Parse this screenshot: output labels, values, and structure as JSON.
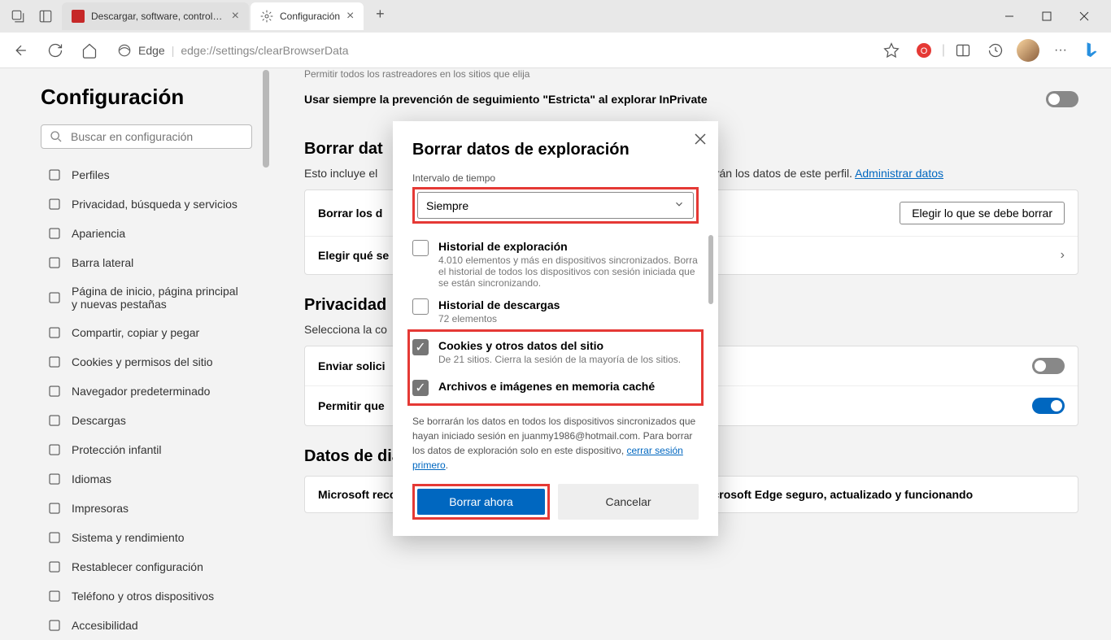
{
  "titlebar": {
    "tab1": "Descargar, software, controlador...",
    "tab2": "Configuración"
  },
  "toolbar": {
    "edge_label": "Edge",
    "url": "edge://settings/clearBrowserData"
  },
  "sidebar": {
    "title": "Configuración",
    "search_placeholder": "Buscar en configuración",
    "items": [
      "Perfiles",
      "Privacidad, búsqueda y servicios",
      "Apariencia",
      "Barra lateral",
      "Página de inicio, página principal y nuevas pestañas",
      "Compartir, copiar y pegar",
      "Cookies y permisos del sitio",
      "Navegador predeterminado",
      "Descargas",
      "Protección infantil",
      "Idiomas",
      "Impresoras",
      "Sistema y rendimiento",
      "Restablecer configuración",
      "Teléfono y otros dispositivos",
      "Accesibilidad"
    ]
  },
  "main": {
    "tracker_sub": "Permitir todos los rastreadores en los sitios que elija",
    "strict_label": "Usar siempre la prevención de seguimiento \"Estricta\" al explorar InPrivate",
    "section1_title": "Borrar dat",
    "section1_desc_pre": "Esto incluye el ",
    "section1_desc_post": "arán los datos de este perfil. ",
    "manage_link": "Administrar datos",
    "card1_row1": "Borrar los d",
    "choose_btn": "Elegir lo que se debe borrar",
    "card1_row2": "Elegir qué se",
    "section2_title": "Privacidad",
    "section2_desc": "Selecciona la co",
    "send_label": "Enviar solici",
    "allow_label": "Permitir que",
    "section3_title": "Datos de diagnóstico requeridos",
    "diag_text": "Microsoft recopila los datos de diagnóstico necesarios para mantener Microsoft Edge seguro, actualizado y funcionando"
  },
  "modal": {
    "title": "Borrar datos de exploración",
    "time_label": "Intervalo de tiempo",
    "time_value": "Siempre",
    "items": [
      {
        "title": "Historial de exploración",
        "desc": "4.010 elementos y más en dispositivos sincronizados. Borra el historial de todos los dispositivos con sesión iniciada que se están sincronizando.",
        "checked": false
      },
      {
        "title": "Historial de descargas",
        "desc": "72 elementos",
        "checked": false
      },
      {
        "title": "Cookies y otros datos del sitio",
        "desc": "De 21 sitios. Cierra la sesión de la mayoría de los sitios.",
        "checked": true
      },
      {
        "title": "Archivos e imágenes en memoria caché",
        "desc": "",
        "checked": true
      }
    ],
    "note_pre": "Se borrarán los datos en todos los dispositivos sincronizados que hayan iniciado sesión en juanmy1986@hotmail.com. Para borrar los datos de exploración solo en este dispositivo, ",
    "note_link": "cerrar sesión primero",
    "clear_btn": "Borrar ahora",
    "cancel_btn": "Cancelar"
  }
}
